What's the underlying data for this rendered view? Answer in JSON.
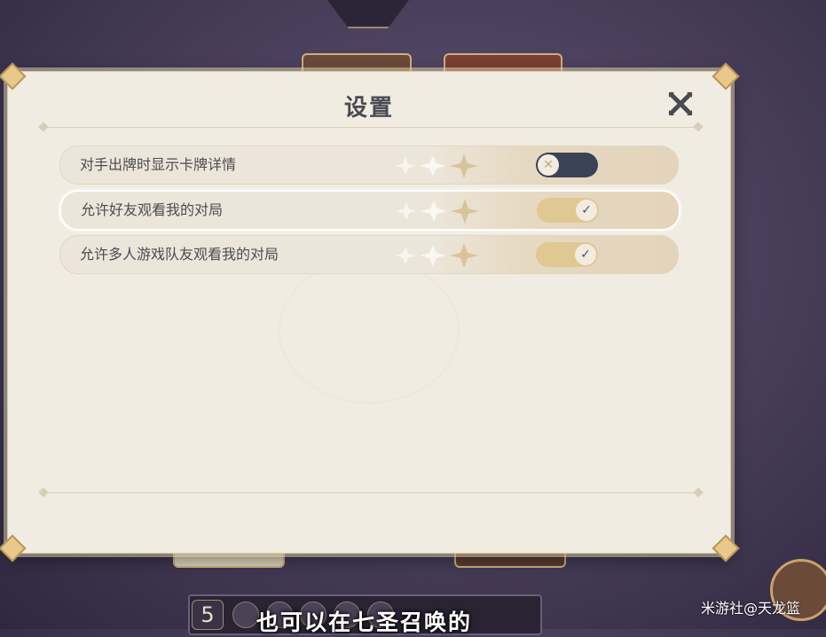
{
  "dialog": {
    "title": "设置",
    "close_icon": "close-icon",
    "settings": [
      {
        "label": "对手出牌时显示卡牌详情",
        "enabled": false,
        "toggle_icon": "x-icon",
        "toggle_glyph": "✕"
      },
      {
        "label": "允许好友观看我的对局",
        "enabled": true,
        "focused": true,
        "toggle_icon": "check-icon",
        "toggle_glyph": "✓"
      },
      {
        "label": "允许多人游戏队友观看我的对局",
        "enabled": true,
        "toggle_icon": "check-icon",
        "toggle_glyph": "✓"
      }
    ]
  },
  "background": {
    "dice_count": "5",
    "subtitle": "也可以在七圣召唤的",
    "watermark": "米游社@天龙篮"
  },
  "colors": {
    "panel": "#f1ece1",
    "toggle_on": "#e0c892",
    "toggle_off": "#3a4256",
    "title_text": "#4a4a52"
  }
}
